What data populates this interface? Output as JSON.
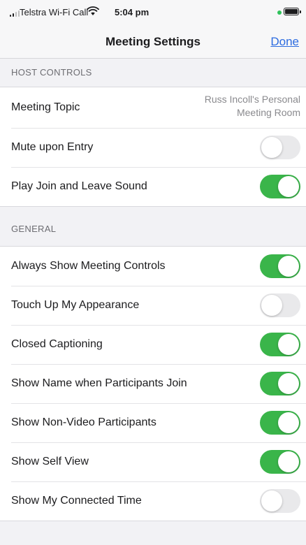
{
  "status_bar": {
    "carrier": "Telstra Wi-Fi Call",
    "time": "5:04 pm"
  },
  "nav": {
    "title": "Meeting Settings",
    "done_label": "Done"
  },
  "host_controls": {
    "header": "HOST CONTROLS",
    "topic_label": "Meeting Topic",
    "topic_value_line1": "Russ Incoll's Personal",
    "topic_value_line2": "Meeting Room",
    "items": [
      {
        "label": "Mute upon Entry",
        "on": false
      },
      {
        "label": "Play Join and Leave Sound",
        "on": true
      }
    ]
  },
  "general": {
    "header": "GENERAL",
    "items": [
      {
        "label": "Always Show Meeting Controls",
        "on": true
      },
      {
        "label": "Touch Up My Appearance",
        "on": false
      },
      {
        "label": "Closed Captioning",
        "on": true
      },
      {
        "label": "Show Name when Participants Join",
        "on": true
      },
      {
        "label": "Show Non-Video Participants",
        "on": true
      },
      {
        "label": "Show Self View",
        "on": true
      },
      {
        "label": "Show My Connected Time",
        "on": false
      }
    ]
  },
  "colors": {
    "toggle_on": "#3ab54a",
    "toggle_off": "#e9e9eb",
    "link": "#2d6ce0"
  }
}
